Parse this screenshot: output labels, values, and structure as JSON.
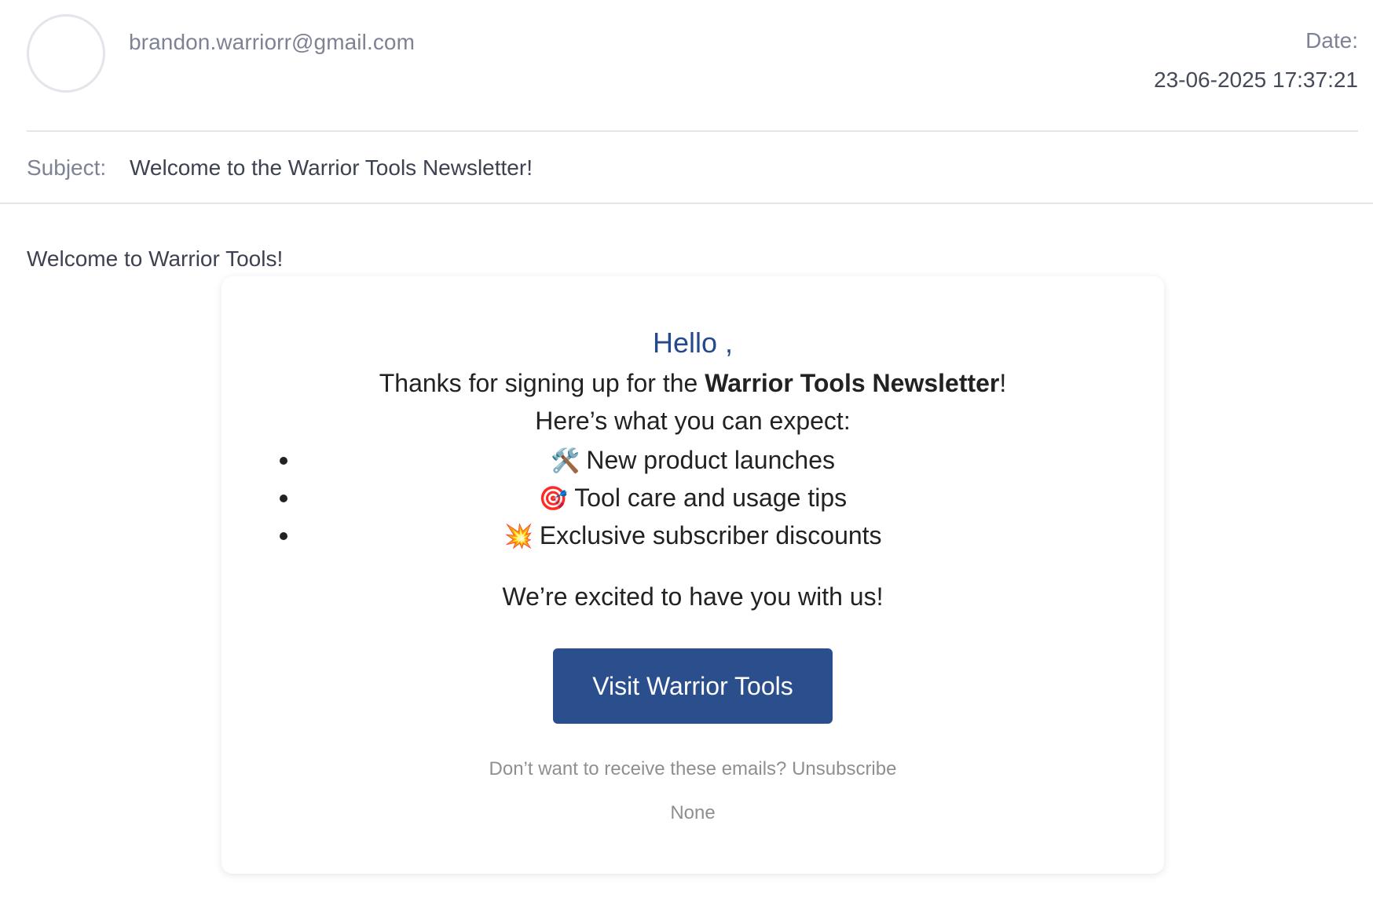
{
  "header": {
    "sender_email": "brandon.warriorr@gmail.com",
    "date_label": "Date:",
    "date_value": "23-06-2025 17:37:21"
  },
  "subject": {
    "label": "Subject:",
    "text": "Welcome to the Warrior Tools Newsletter!"
  },
  "body": {
    "intro": "Welcome to Warrior Tools!",
    "card": {
      "greeting": "Hello ,",
      "thanks_prefix": "Thanks for signing up for the ",
      "thanks_bold": "Warrior Tools Newsletter",
      "thanks_suffix": "!",
      "expect": "Here’s what you can expect:",
      "benefits": [
        {
          "icon": "hammer-and-wrench-icon",
          "emoji": "🛠️",
          "text": "New product launches"
        },
        {
          "icon": "target-icon",
          "emoji": "🎯",
          "text": "Tool care and usage tips"
        },
        {
          "icon": "collision-icon",
          "emoji": "💥",
          "text": "Exclusive subscriber discounts"
        }
      ],
      "excited": "We’re excited to have you with us!",
      "cta_label": "Visit Warrior Tools",
      "unsubscribe_prefix": "Don’t want to receive these emails? ",
      "unsubscribe_link": "Unsubscribe",
      "footer": "None"
    }
  },
  "colors": {
    "accent": "#2b4e8c",
    "greeting": "#244a8a",
    "muted_text": "#7d8394",
    "footer_text": "#8f8f8f"
  }
}
